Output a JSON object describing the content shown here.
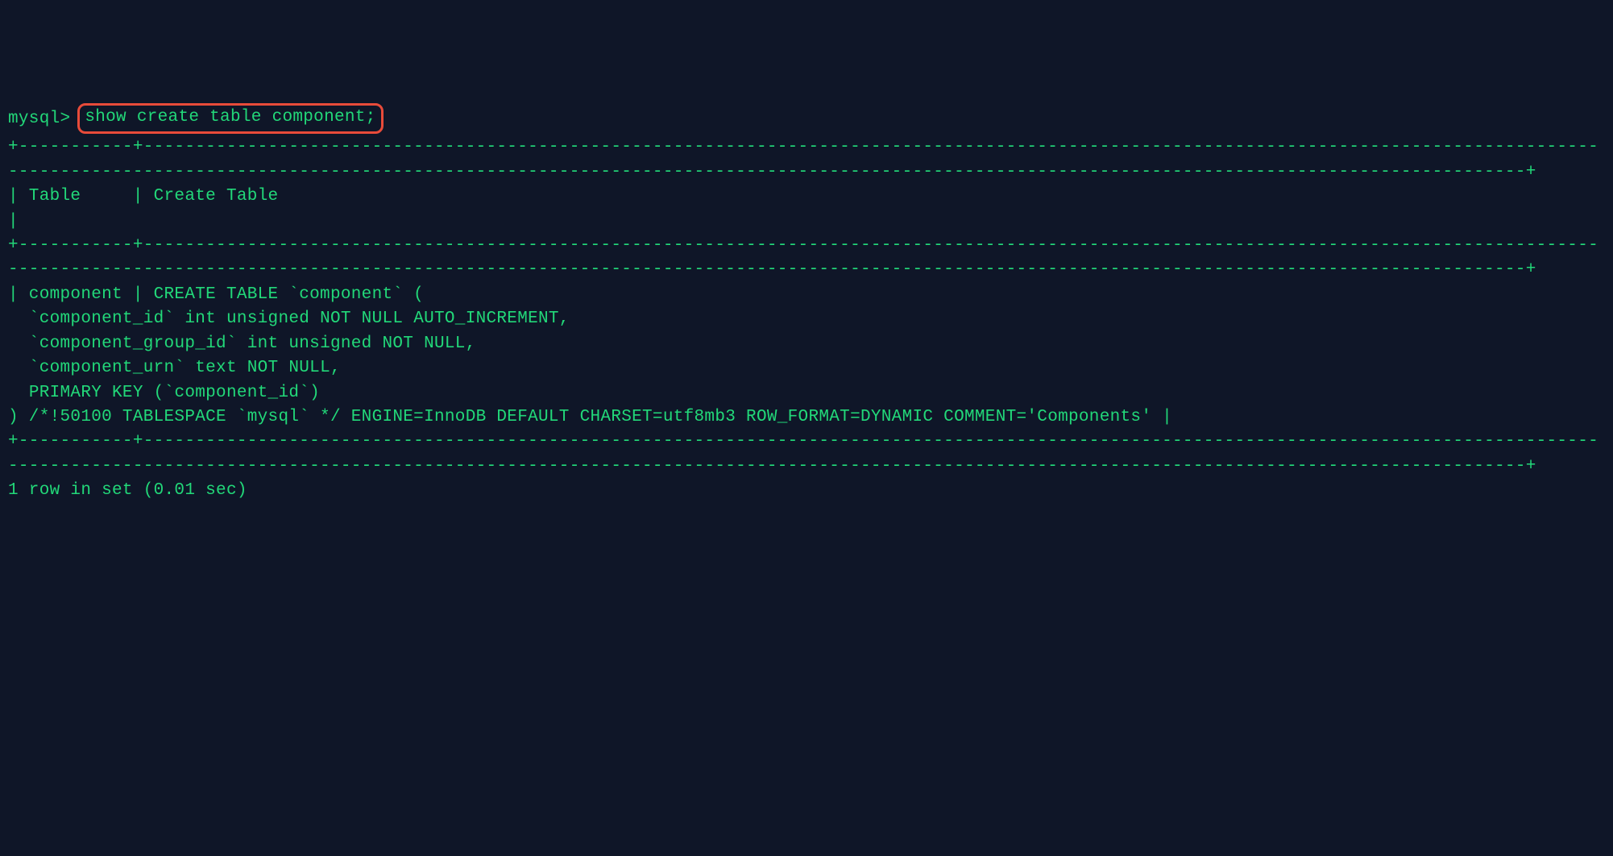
{
  "prompt": "mysql>",
  "command": "show create table component;",
  "border_top": "+-----------+----------------------------------------------------------------------------------------------------------------------------------------------------------------------------------------------------------------------------------------------------------------------------------------------+",
  "header_line": "| Table     | Create Table                                                                                                                                                                                                                                                                                 |",
  "border_mid": "+-----------+----------------------------------------------------------------------------------------------------------------------------------------------------------------------------------------------------------------------------------------------------------------------------------------------+",
  "body_line1": "| component | CREATE TABLE `component` (",
  "body_line2": "  `component_id` int unsigned NOT NULL AUTO_INCREMENT,",
  "body_line3": "  `component_group_id` int unsigned NOT NULL,",
  "body_line4": "  `component_urn` text NOT NULL,",
  "body_line5": "  PRIMARY KEY (`component_id`)",
  "body_line6": ") /*!50100 TABLESPACE `mysql` */ ENGINE=InnoDB DEFAULT CHARSET=utf8mb3 ROW_FORMAT=DYNAMIC COMMENT='Components' |",
  "border_bot": "+-----------+----------------------------------------------------------------------------------------------------------------------------------------------------------------------------------------------------------------------------------------------------------------------------------------------+",
  "footer": "1 row in set (0.01 sec)"
}
